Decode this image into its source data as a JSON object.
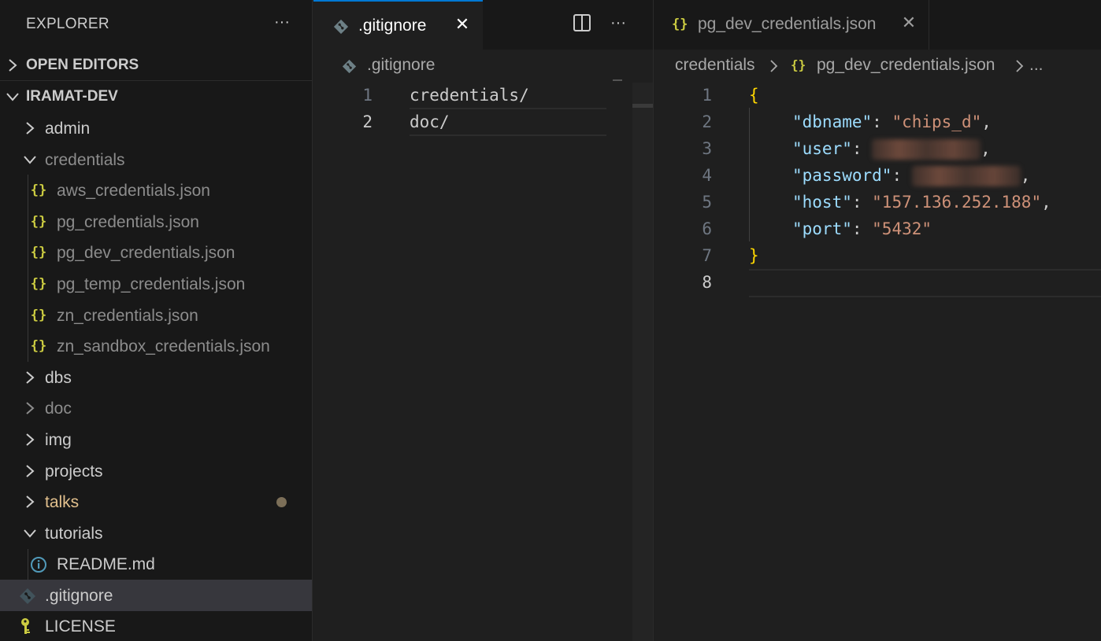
{
  "sidebar": {
    "title": "EXPLORER",
    "more_actions": "···",
    "open_editors_label": "OPEN EDITORS",
    "workspace_label": "IRAMAT-DEV",
    "tree": [
      {
        "label": "admin",
        "type": "folder",
        "expanded": false
      },
      {
        "label": "credentials",
        "type": "folder",
        "expanded": true,
        "dim": true
      },
      {
        "label": "aws_credentials.json",
        "type": "json"
      },
      {
        "label": "pg_credentials.json",
        "type": "json"
      },
      {
        "label": "pg_dev_credentials.json",
        "type": "json"
      },
      {
        "label": "pg_temp_credentials.json",
        "type": "json"
      },
      {
        "label": "zn_credentials.json",
        "type": "json"
      },
      {
        "label": "zn_sandbox_credentials.json",
        "type": "json"
      },
      {
        "label": "dbs",
        "type": "folder",
        "expanded": false
      },
      {
        "label": "doc",
        "type": "folder",
        "expanded": false,
        "dim": true
      },
      {
        "label": "img",
        "type": "folder",
        "expanded": false
      },
      {
        "label": "projects",
        "type": "folder",
        "expanded": false
      },
      {
        "label": "talks",
        "type": "folder",
        "expanded": false,
        "modified": true
      },
      {
        "label": "tutorials",
        "type": "folder",
        "expanded": true
      },
      {
        "label": "README.md",
        "type": "info"
      },
      {
        "label": ".gitignore",
        "type": "git",
        "selected": true
      },
      {
        "label": "LICENSE",
        "type": "license"
      }
    ]
  },
  "json_icon": "{}",
  "group1": {
    "tab_label": ".gitignore",
    "tab_close": "✕",
    "breadcrumb": ".gitignore",
    "lines": [
      {
        "n": "1",
        "text": "credentials/"
      },
      {
        "n": "2",
        "text": "doc/"
      }
    ]
  },
  "group2": {
    "tab_label": "pg_dev_credentials.json",
    "tab_close": "✕",
    "breadcrumb": {
      "folder": "credentials",
      "file": "pg_dev_credentials.json",
      "more": "..."
    },
    "line_numbers": [
      "1",
      "2",
      "3",
      "4",
      "5",
      "6",
      "7",
      "8"
    ],
    "json": {
      "open_brace": "{",
      "close_brace": "}",
      "k_dbname": "\"dbname\"",
      "v_dbname": "\"chips_d\"",
      "k_user": "\"user\"",
      "k_password": "\"password\"",
      "k_host": "\"host\"",
      "v_host": "\"157.136.252.188\"",
      "k_port": "\"port\"",
      "v_port": "\"5432\"",
      "colon": ": ",
      "comma": ","
    }
  },
  "colors": {
    "accent": "#0078d4",
    "json_icon": "#cbcb41",
    "key": "#9cdcfe",
    "string": "#ce9178",
    "brace": "#ffd700",
    "modified_folder": "#e2c08d"
  }
}
